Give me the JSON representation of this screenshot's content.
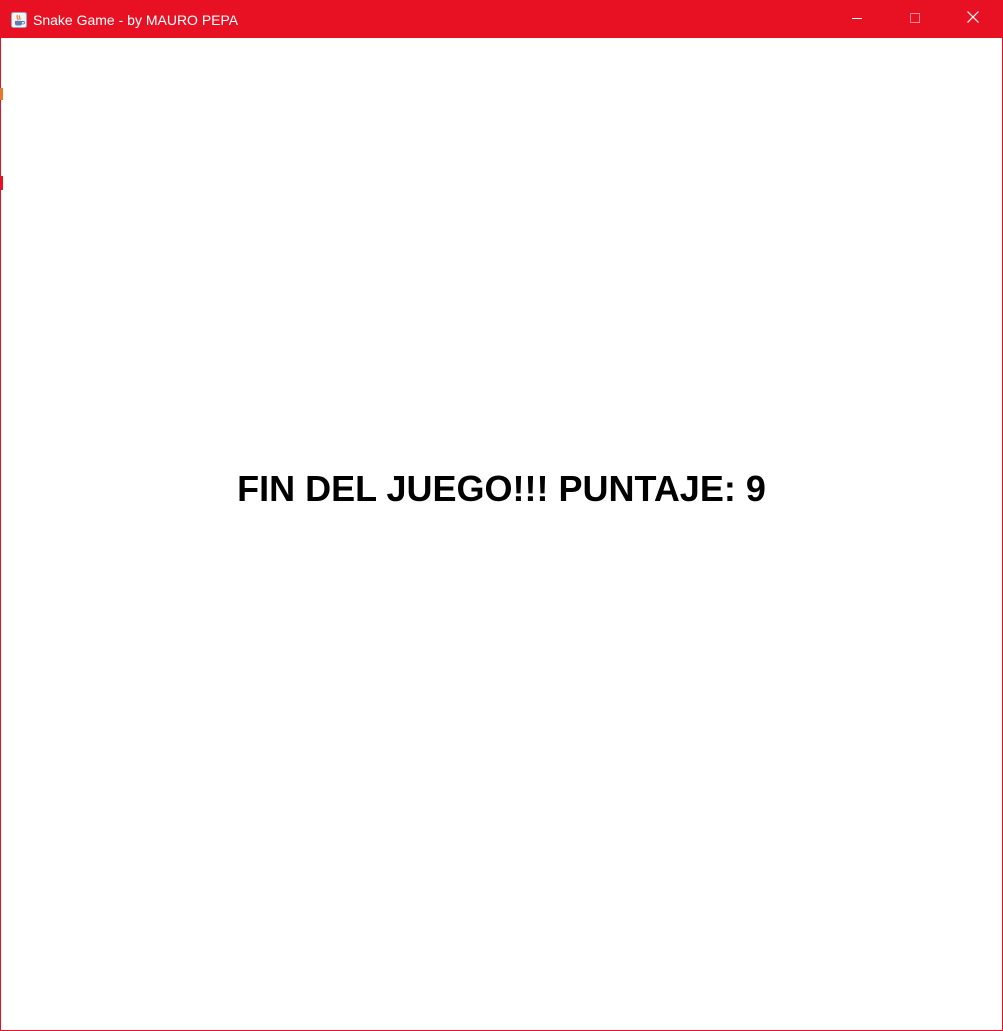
{
  "window": {
    "title": "Snake Game - by MAURO PEPA",
    "icon": "java-cup-icon",
    "accent_color": "#e81123"
  },
  "controls": {
    "minimize_icon": "minimize-icon",
    "maximize_icon": "maximize-icon",
    "close_icon": "close-icon"
  },
  "game": {
    "message": "FIN DEL JUEGO!!! PUNTAJE: 9",
    "background_color": "#ffffff",
    "text_color": "#000000"
  }
}
